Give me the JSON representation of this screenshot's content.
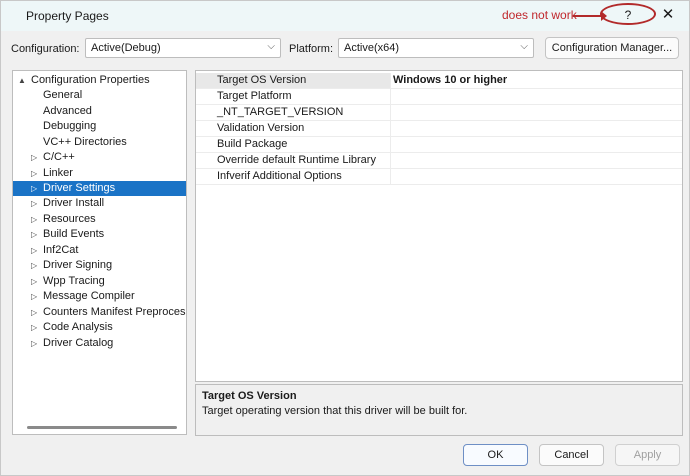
{
  "window": {
    "title": "Property Pages",
    "help_label": "?",
    "close_label": "✕",
    "annotation": "does not work"
  },
  "toolbar": {
    "configuration_label": "Configuration:",
    "configuration_value": "Active(Debug)",
    "platform_label": "Platform:",
    "platform_value": "Active(x64)",
    "config_manager_label": "Configuration Manager..."
  },
  "tree": {
    "items": [
      {
        "label": "Configuration Properties",
        "expand": "▲"
      },
      {
        "label": "General"
      },
      {
        "label": "Advanced"
      },
      {
        "label": "Debugging"
      },
      {
        "label": "VC++ Directories"
      },
      {
        "label": "C/C++",
        "expand": "▷"
      },
      {
        "label": "Linker",
        "expand": "▷"
      },
      {
        "label": "Driver Settings",
        "expand": "▷"
      },
      {
        "label": "Driver Install",
        "expand": "▷"
      },
      {
        "label": "Resources",
        "expand": "▷"
      },
      {
        "label": "Build Events",
        "expand": "▷"
      },
      {
        "label": "Inf2Cat",
        "expand": "▷"
      },
      {
        "label": "Driver Signing",
        "expand": "▷"
      },
      {
        "label": "Wpp Tracing",
        "expand": "▷"
      },
      {
        "label": "Message Compiler",
        "expand": "▷"
      },
      {
        "label": "Counters Manifest Preprocesso",
        "expand": "▷"
      },
      {
        "label": "Code Analysis",
        "expand": "▷"
      },
      {
        "label": "Driver Catalog",
        "expand": "▷"
      }
    ]
  },
  "grid": {
    "rows": [
      {
        "name": "Target OS Version",
        "value": "Windows 10 or higher"
      },
      {
        "name": "Target Platform",
        "value": ""
      },
      {
        "name": "_NT_TARGET_VERSION",
        "value": ""
      },
      {
        "name": "Validation Version",
        "value": ""
      },
      {
        "name": "Build Package",
        "value": ""
      },
      {
        "name": "Override default Runtime Library",
        "value": ""
      },
      {
        "name": "Infverif Additional Options",
        "value": ""
      }
    ]
  },
  "description": {
    "title": "Target OS Version",
    "text": "Target operating version that this driver will be built for."
  },
  "buttons": {
    "ok": "OK",
    "cancel": "Cancel",
    "apply": "Apply"
  }
}
